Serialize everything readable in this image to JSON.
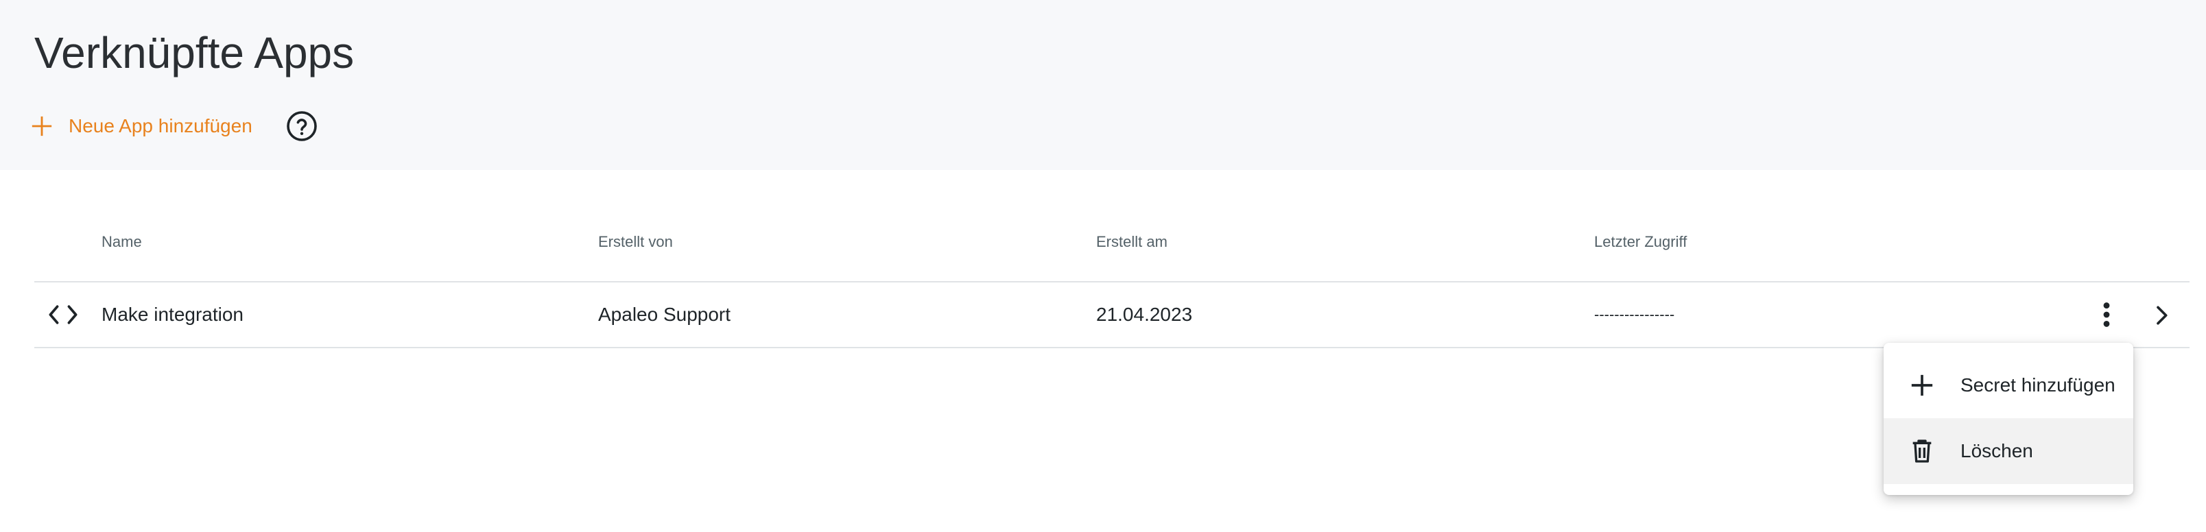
{
  "page": {
    "title": "Verknüpfte Apps",
    "add_app_label": "Neue App hinzufügen"
  },
  "colors": {
    "accent": "#e8821e",
    "header_bg": "#f7f8fa"
  },
  "table": {
    "columns": [
      "Name",
      "Erstellt von",
      "Erstellt am",
      "Letzter Zugriff"
    ],
    "rows": [
      {
        "icon": "code-icon",
        "name": "Make integration",
        "created_by": "Apaleo Support",
        "created_at": "21.04.2023",
        "last_access": "----------------"
      }
    ]
  },
  "context_menu": {
    "items": [
      {
        "icon": "plus-icon",
        "label": "Secret hinzufügen"
      },
      {
        "icon": "trash-icon",
        "label": "Löschen"
      }
    ]
  }
}
